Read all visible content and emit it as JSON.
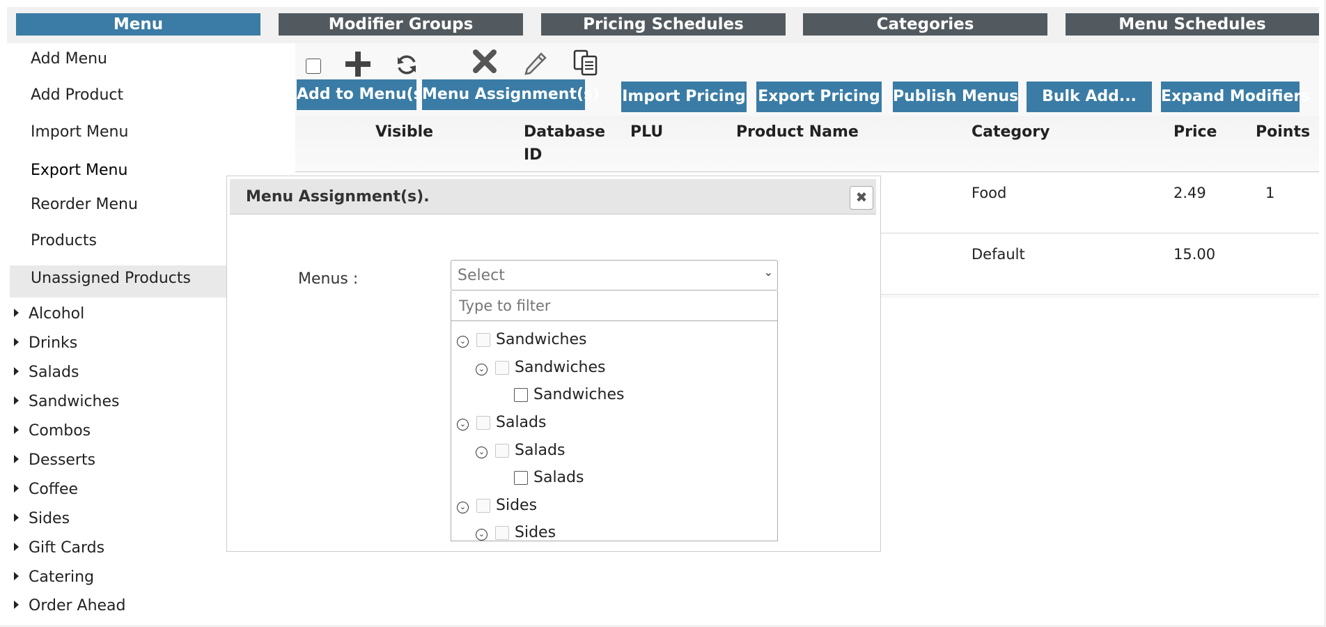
{
  "tabs": [
    {
      "label": "Menu",
      "active": true
    },
    {
      "label": "Modifier Groups",
      "active": false
    },
    {
      "label": "Pricing Schedules",
      "active": false
    },
    {
      "label": "Categories",
      "active": false
    },
    {
      "label": "Menu Schedules",
      "active": false
    }
  ],
  "sidebar": {
    "links": [
      "Add Menu",
      "Add Product",
      "Import Menu",
      "Export Menu",
      "Reorder Menu",
      "Products",
      "Unassigned Products"
    ],
    "selected": "Unassigned Products",
    "tree": [
      "Alcohol",
      "Drinks",
      "Salads",
      "Sandwiches",
      "Combos",
      "Desserts",
      "Coffee",
      "Sides",
      "Gift Cards",
      "Catering",
      "Order Ahead"
    ]
  },
  "toolbar": {
    "icons": [
      "select-all-checkbox",
      "add-icon",
      "refresh-icon",
      "delete-icon",
      "edit-icon",
      "copy-icon"
    ],
    "buttons": {
      "add_to_menus": "Add to Menu(s)",
      "menu_assignments": "Menu Assignment(s)",
      "import_pricing": "Import Pricing",
      "export_pricing": "Export Pricing",
      "publish_menus": "Publish Menus",
      "bulk_add": "Bulk Add...",
      "expand_modifiers": "Expand Modifiers"
    }
  },
  "grid": {
    "columns": {
      "visible": "Visible",
      "database_id_1": "Database",
      "database_id_2": "ID",
      "plu": "PLU",
      "product_name": "Product Name",
      "category": "Category",
      "price": "Price",
      "points": "Points"
    },
    "rows": [
      {
        "category": "Food",
        "price": "2.49",
        "points": "1"
      },
      {
        "category": "Default",
        "price": "15.00",
        "points": ""
      }
    ]
  },
  "dialog": {
    "title": "Menu Assignment(s).",
    "close_icon": "close-icon",
    "menus_label": "Menus :",
    "select_value": "Select",
    "filter_placeholder": "Type to filter",
    "tree": [
      {
        "label": "Sandwiches",
        "level": 0
      },
      {
        "label": "Sandwiches",
        "level": 1
      },
      {
        "label": "Sandwiches",
        "level": 2
      },
      {
        "label": "Salads",
        "level": 0
      },
      {
        "label": "Salads",
        "level": 1
      },
      {
        "label": "Salads",
        "level": 2
      },
      {
        "label": "Sides",
        "level": 0
      },
      {
        "label": "Sides",
        "level": 1
      }
    ]
  },
  "colors": {
    "accent": "#3a7ca5",
    "tab_inactive": "#525a5f"
  }
}
